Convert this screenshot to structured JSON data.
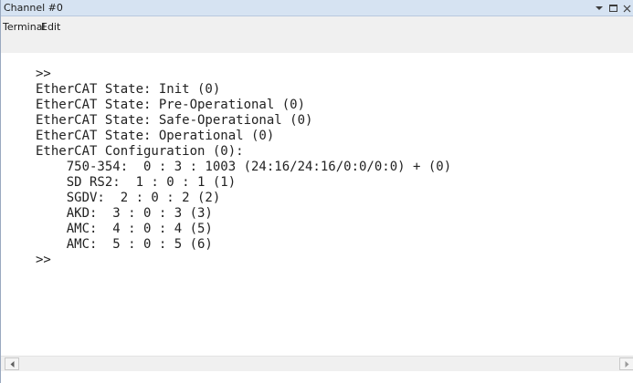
{
  "window": {
    "title": "Channel #0",
    "controls": [
      "dropdown-icon",
      "maximize-icon",
      "close-icon"
    ]
  },
  "menu": {
    "items": [
      {
        "label": "Terminal"
      },
      {
        "label": "Edit"
      }
    ]
  },
  "terminal": {
    "lines": [
      ">>",
      "EtherCAT State: Init (0)",
      "EtherCAT State: Pre-Operational (0)",
      "EtherCAT State: Safe-Operational (0)",
      "EtherCAT State: Operational (0)",
      "EtherCAT Configuration (0):",
      "    750-354:  0 : 3 : 1003 (24:16/24:16/0:0/0:0) + (0)",
      "    SD RS2:  1 : 0 : 1 (1)",
      "    SGDV:  2 : 0 : 2 (2)",
      "    AKD:  3 : 0 : 3 (3)",
      "    AMC:  4 : 0 : 4 (5)",
      "    AMC:  5 : 0 : 5 (6)",
      ">>"
    ]
  },
  "colors": {
    "titlebar_bg": "#d6e3f2",
    "menubar_bg": "#f0f0f0",
    "text": "#222222"
  }
}
